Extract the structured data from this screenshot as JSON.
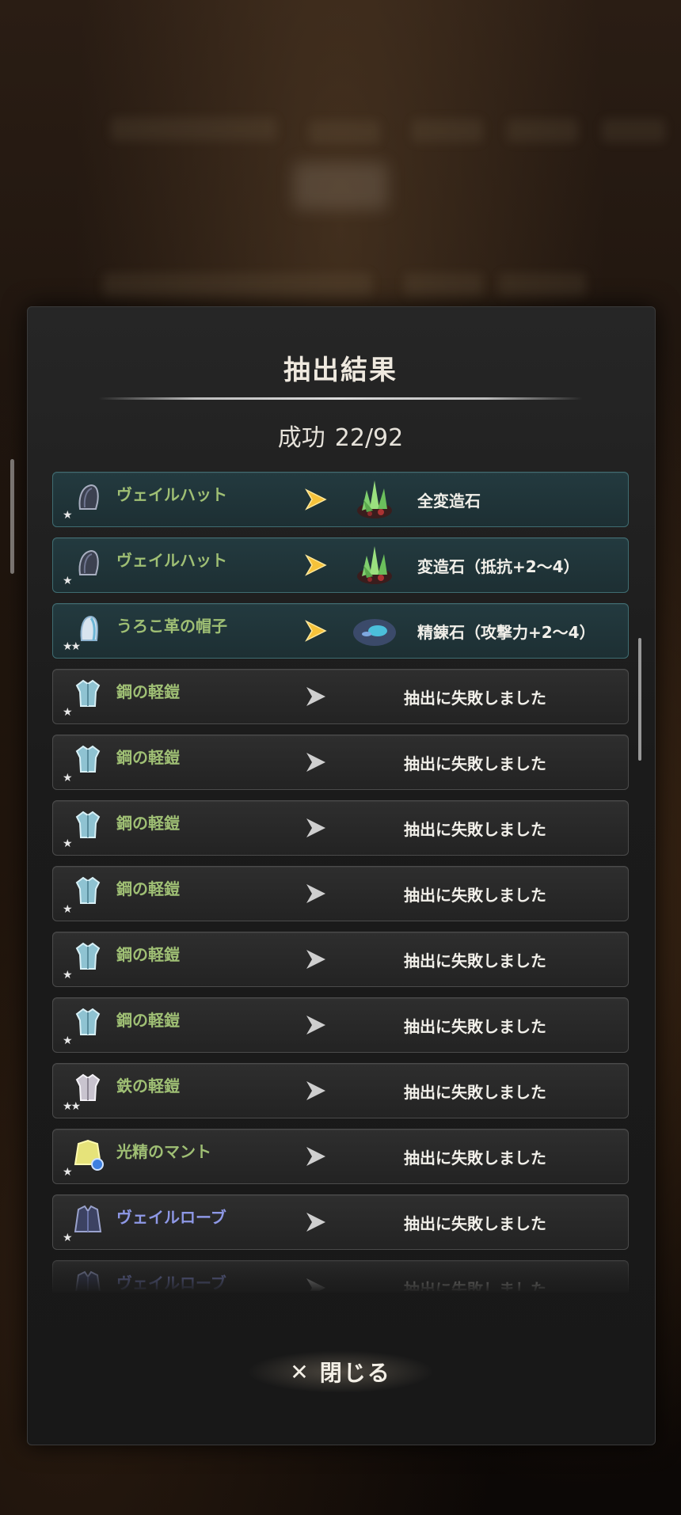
{
  "dialog": {
    "title": "抽出結果",
    "success_label": "成功",
    "success_count": "22/92",
    "close_label": "閉じる"
  },
  "results": [
    {
      "name": "ヴェイルハット",
      "stars": "★",
      "success": true,
      "result": "全変造石",
      "result_icon": "green-crystal-ore-icon"
    },
    {
      "name": "ヴェイルハット",
      "stars": "★",
      "success": true,
      "result": "変造石（抵抗+2～4）",
      "result_icon": "green-crystal-ore-icon"
    },
    {
      "name": "うろこ革の帽子",
      "stars": "★★",
      "success": true,
      "result": "精錬石（攻撃力+2～4）",
      "result_icon": "blue-refining-stone-icon"
    },
    {
      "name": "鋼の軽鎧",
      "stars": "★",
      "success": false,
      "result": "抽出に失敗しました"
    },
    {
      "name": "鋼の軽鎧",
      "stars": "★",
      "success": false,
      "result": "抽出に失敗しました"
    },
    {
      "name": "鋼の軽鎧",
      "stars": "★",
      "success": false,
      "result": "抽出に失敗しました"
    },
    {
      "name": "鋼の軽鎧",
      "stars": "★",
      "success": false,
      "result": "抽出に失敗しました"
    },
    {
      "name": "鋼の軽鎧",
      "stars": "★",
      "success": false,
      "result": "抽出に失敗しました"
    },
    {
      "name": "鋼の軽鎧",
      "stars": "★",
      "success": false,
      "result": "抽出に失敗しました"
    },
    {
      "name": "鉄の軽鎧",
      "stars": "★★",
      "success": false,
      "result": "抽出に失敗しました"
    },
    {
      "name": "光精のマント",
      "stars": "★",
      "success": false,
      "result": "抽出に失敗しました"
    },
    {
      "name": "ヴェイルローブ",
      "stars": "★",
      "success": false,
      "result": "抽出に失敗しました"
    },
    {
      "name": "ヴェイルローブ",
      "stars": "★",
      "success": false,
      "result": "抽出に失敗しました"
    }
  ]
}
